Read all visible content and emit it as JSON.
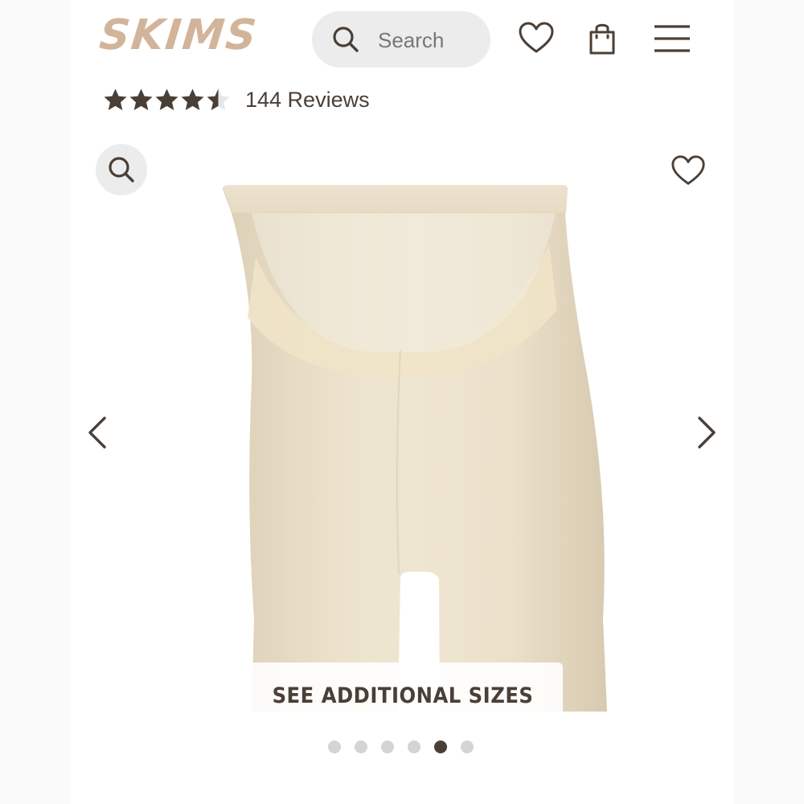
{
  "header": {
    "logo_text": "SKIMS",
    "search_placeholder": "Search",
    "icons": [
      "search-icon",
      "heart-icon",
      "shopping-bag-icon",
      "hamburger-menu-icon"
    ]
  },
  "rating": {
    "stars_value": 4.5,
    "stars_max": 5,
    "reviews_label": "144 Reviews"
  },
  "gallery": {
    "see_additional_sizes_label": "SEE ADDITIONAL SIZES",
    "slide_count": 6,
    "active_slide": 5,
    "product_color": "#e8dcc4",
    "icons": [
      "zoom-icon",
      "heart-icon",
      "chevron-left-icon",
      "chevron-right-icon"
    ]
  },
  "colors": {
    "brand": "#d2b49a",
    "text": "#4a3f36",
    "search_bg": "#ececec"
  }
}
